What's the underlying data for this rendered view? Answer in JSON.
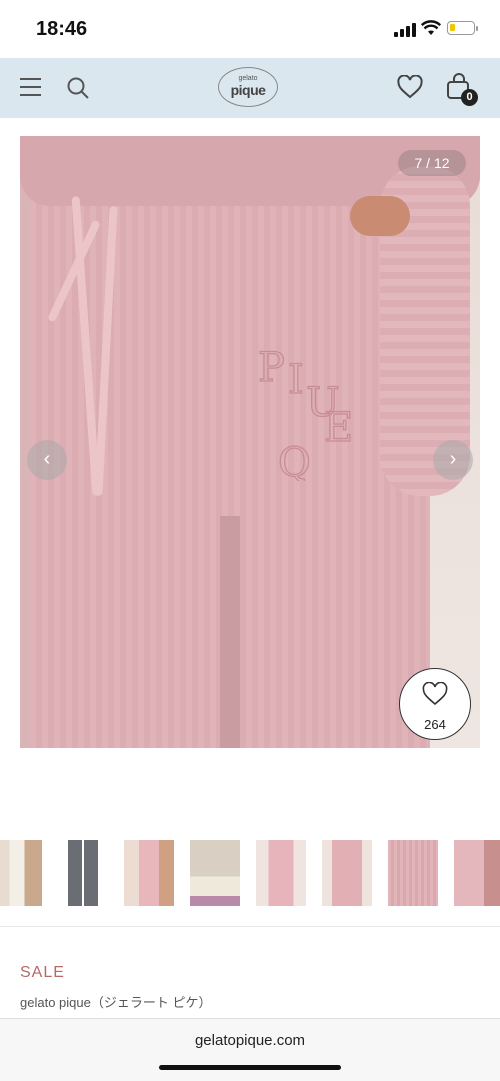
{
  "status_bar": {
    "time": "18:46"
  },
  "header": {
    "logo_small": "gelato",
    "logo_main": "pique",
    "cart_count": "0"
  },
  "gallery": {
    "counter": "7 / 12",
    "prev": "‹",
    "next": "›",
    "favorite_count": "264"
  },
  "product": {
    "sale_label": "SALE",
    "brand": "gelato pique（ジェラート ピケ）"
  },
  "browser": {
    "url": "gelatopique.com"
  },
  "icons": [
    "menu-icon",
    "search-icon",
    "heart-icon",
    "shopping-bag-icon",
    "chevron-left-icon",
    "chevron-right-icon",
    "favorite-heart-icon"
  ],
  "colors": {
    "header_bg": "#dbe7ef",
    "sale": "#b56a6a",
    "product_pink": "#dbacb1"
  }
}
